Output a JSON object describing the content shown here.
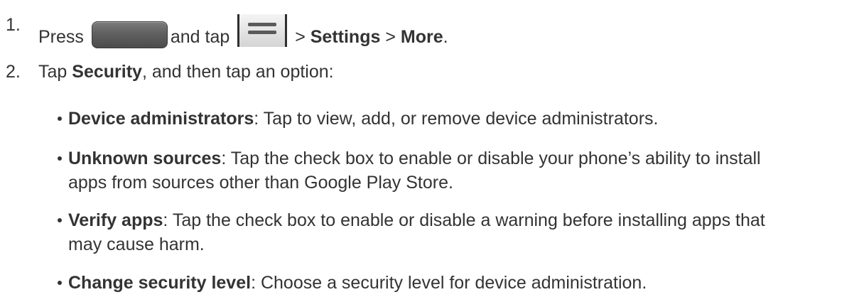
{
  "steps": [
    {
      "number": "1.",
      "text_press": "Press",
      "text_and_tap": "and tap",
      "sep1": ">",
      "settings": "Settings",
      "sep2": ">",
      "more": "More",
      "end": "."
    },
    {
      "number": "2.",
      "text_tap": "Tap",
      "security": "Security",
      "rest": ", and then tap an option:"
    }
  ],
  "options": [
    {
      "title": "Device administrators",
      "desc": ": Tap to view, add, or remove device administrators."
    },
    {
      "title": "Unknown sources",
      "desc_line1": ": Tap the check box to enable or disable your phone’s ability to install",
      "desc_line2": "apps from sources other than Google Play Store."
    },
    {
      "title": "Verify apps",
      "desc_line1": ": Tap the check box to enable or disable a warning before installing apps that",
      "desc_line2": "may cause harm."
    },
    {
      "title": "Change security level",
      "desc": ": Choose a security level for device administration."
    }
  ],
  "icons": {
    "home_button": "home-key-icon",
    "menu_button": "menu-key-icon"
  }
}
